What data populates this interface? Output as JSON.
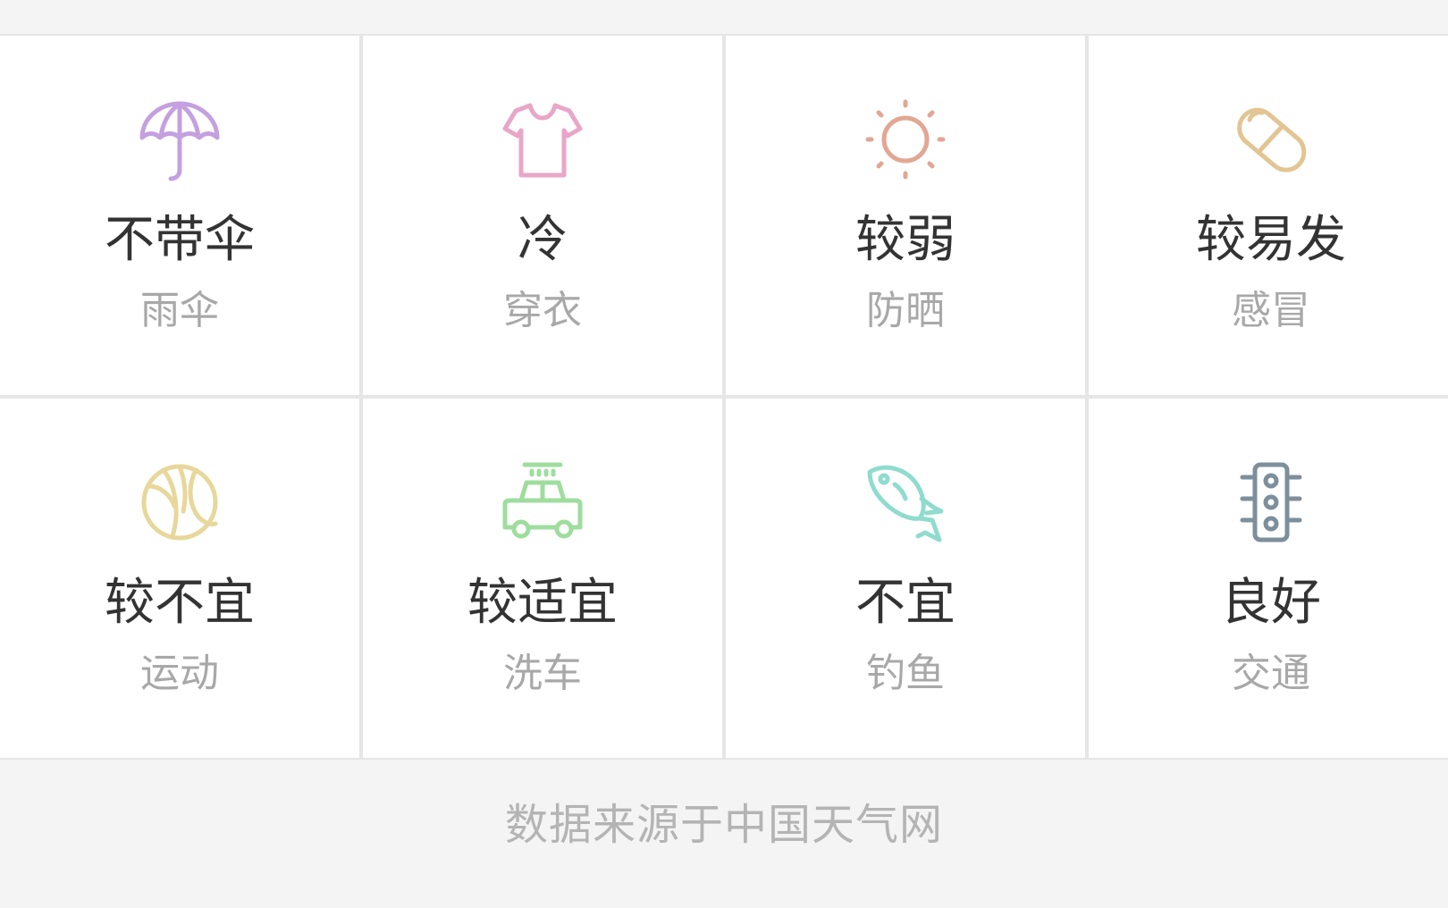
{
  "indices": [
    {
      "id": "umbrella",
      "value": "不带伞",
      "label": "雨伞",
      "icon": "umbrella-icon",
      "color": "#c4a0e0"
    },
    {
      "id": "clothing",
      "value": "冷",
      "label": "穿衣",
      "icon": "tshirt-icon",
      "color": "#e9a6c8"
    },
    {
      "id": "sunscreen",
      "value": "较弱",
      "label": "防晒",
      "icon": "sun-icon",
      "color": "#e2a794"
    },
    {
      "id": "cold",
      "value": "较易发",
      "label": "感冒",
      "icon": "pill-icon",
      "color": "#e2c592"
    },
    {
      "id": "sport",
      "value": "较不宜",
      "label": "运动",
      "icon": "basketball-icon",
      "color": "#e7d79a"
    },
    {
      "id": "carwash",
      "value": "较适宜",
      "label": "洗车",
      "icon": "car-wash-icon",
      "color": "#9edd9e"
    },
    {
      "id": "fishing",
      "value": "不宜",
      "label": "钓鱼",
      "icon": "fish-icon",
      "color": "#8fdccf"
    },
    {
      "id": "traffic",
      "value": "良好",
      "label": "交通",
      "icon": "traffic-light-icon",
      "color": "#7d8f9c"
    }
  ],
  "footer": {
    "source": "数据来源于中国天气网"
  }
}
